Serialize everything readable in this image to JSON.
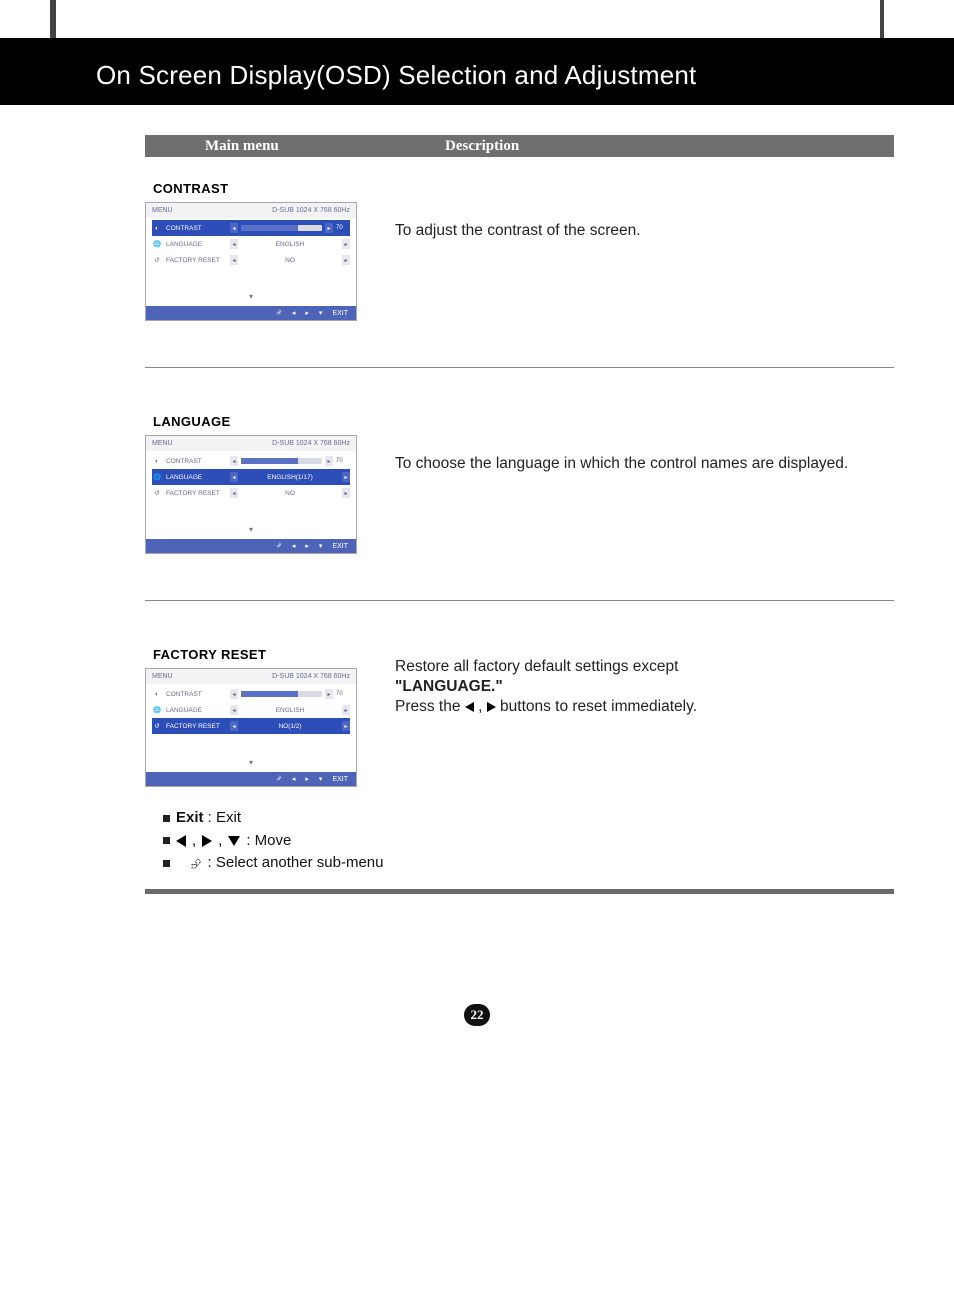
{
  "page_title": "On Screen Display(OSD) Selection and Adjustment",
  "table_header": {
    "col1": "Main menu",
    "col2": "Description"
  },
  "osd_common": {
    "menu_label": "MENU",
    "signal": "D-SUB 1024 X 768 60Hz",
    "row_contrast": "CONTRAST",
    "row_language": "LANGUAGE",
    "row_factory": "FACTORY RESET",
    "slider_value": "70",
    "exit_label": "EXIT"
  },
  "sections": {
    "contrast": {
      "title": "CONTRAST",
      "description": "To adjust the contrast of the screen.",
      "values": {
        "language": "ENGLISH",
        "factory": "NO"
      }
    },
    "language": {
      "title": "LANGUAGE",
      "description": "To choose the language in which the control names are displayed.",
      "values": {
        "language": "ENGLISH(1/17)",
        "factory": "NO"
      }
    },
    "factory": {
      "title": "FACTORY RESET",
      "desc_line1": "Restore all factory default settings except",
      "desc_bold": "\"LANGUAGE.\"",
      "desc_press_pre": "Press the ",
      "desc_press_post": "  buttons to reset immediately.",
      "values": {
        "language": "ENGLISH",
        "factory": "NO(1/2)"
      }
    }
  },
  "legend": {
    "exit_bold": "Exit",
    "exit_rest": " : Exit",
    "move_label": "   : Move",
    "submenu_label": "   : Select another sub-menu"
  },
  "page_number": "22"
}
